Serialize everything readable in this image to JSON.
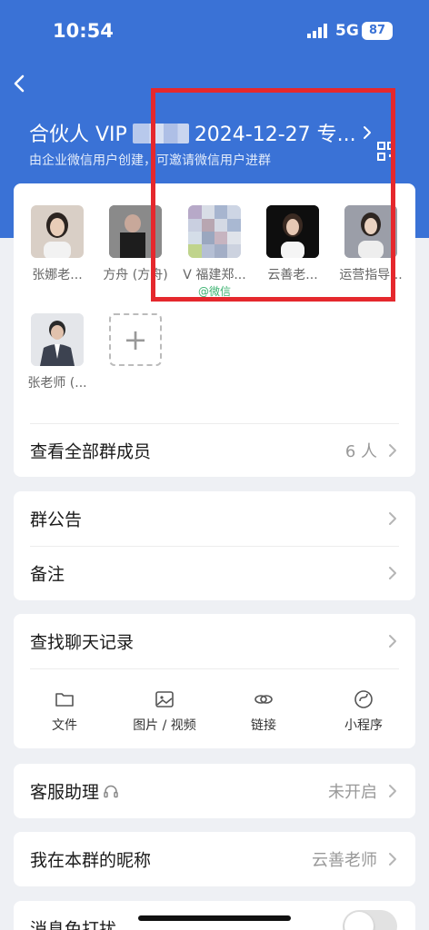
{
  "status_bar": {
    "time": "10:54",
    "network": "5G",
    "battery": "87"
  },
  "header": {
    "title_prefix": "合伙人 VIP",
    "title_suffix": "2024-12-27 专...",
    "subtitle": "由企业微信用户创建，可邀请微信用户进群"
  },
  "members": [
    {
      "name": "张娜老...",
      "avatar_color": "#c9b8a8"
    },
    {
      "name": "方舟 (方舟)",
      "avatar_color": "#5a5a5a"
    },
    {
      "name": "V 福建郑...",
      "avatar_color": "#b9c3d8",
      "tag": "@微信"
    },
    {
      "name": "云善老...",
      "avatar_color": "#1a1a1a"
    },
    {
      "name": "运营指导...",
      "avatar_color": "#8d8f99"
    },
    {
      "name": "张老师 (...",
      "avatar_color": "#4a5060"
    }
  ],
  "view_all": {
    "label": "查看全部群成员",
    "count": "6 人"
  },
  "notice": {
    "label": "群公告"
  },
  "remark": {
    "label": "备注"
  },
  "search": {
    "label": "查找聊天记录",
    "tools": [
      {
        "label": "文件",
        "icon": "folder-icon"
      },
      {
        "label": "图片 / 视频",
        "icon": "image-icon"
      },
      {
        "label": "链接",
        "icon": "link-icon"
      },
      {
        "label": "小程序",
        "icon": "mini-program-icon"
      }
    ]
  },
  "customer_service": {
    "label": "客服助理",
    "value": "未开启"
  },
  "nickname": {
    "label": "我在本群的昵称",
    "value": "云善老师"
  },
  "mute": {
    "label": "消息免打扰",
    "enabled": false
  },
  "colors": {
    "brand_blue": "#3a72d6",
    "highlight_red": "#e5282d",
    "wechat_green": "#3cb371"
  }
}
